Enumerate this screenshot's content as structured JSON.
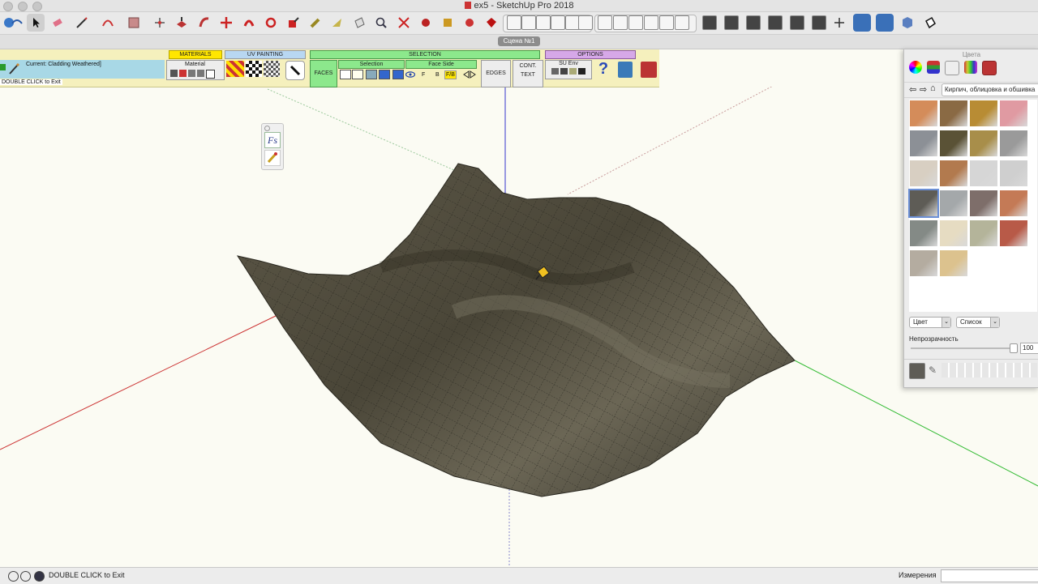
{
  "window": {
    "title": "ex5 - SketchUp Pro 2018"
  },
  "scene_tab": {
    "label": "Сцена №1"
  },
  "plugin": {
    "current_material": "Current: Cladding Weathered]",
    "instruction": "DOUBLE CLICK to Exit",
    "materials_label": "MATERIALS",
    "material_label": "Material",
    "uv_label": "UV PAINTING",
    "selection_header": "SELECTION",
    "faces_label": "FACES",
    "selection_label": "Selection",
    "face_side_label": "Face Side",
    "f_label": "F",
    "b_label": "B",
    "fb_label": "F/B",
    "edges_label": "EDGES",
    "cont_label": "CONT.",
    "text_label": "TEXT",
    "options_label": "OPTIONS",
    "su_env_label": "SU Env",
    "help_glyph": "?"
  },
  "floatbar": {
    "fs_label": "Fs"
  },
  "colors_panel": {
    "title": "Цвета",
    "library": "Кирпич, облицовка и обшивка",
    "swatches": [
      {
        "color": "#d48c5a"
      },
      {
        "color": "#8a6a44"
      },
      {
        "color": "#b88c34"
      },
      {
        "color": "#e09aa2"
      },
      {
        "color": "#8c9096"
      },
      {
        "color": "#5a5236"
      },
      {
        "color": "#a88e4a"
      },
      {
        "color": "#9a9a9a"
      },
      {
        "color": "#d8cfc2"
      },
      {
        "color": "#b27a4e"
      },
      {
        "color": "#d6d6d6"
      },
      {
        "color": "#cfcfcf"
      },
      {
        "color": "#5e5c56",
        "selected": true
      },
      {
        "color": "#a4a8aa"
      },
      {
        "color": "#7e6e6a"
      },
      {
        "color": "#c47a56"
      },
      {
        "color": "#848a86"
      },
      {
        "color": "#e6dcc2"
      },
      {
        "color": "#b4b49a"
      },
      {
        "color": "#b85a48"
      },
      {
        "color": "#b4aca0"
      },
      {
        "color": "#dcc28e"
      }
    ],
    "mode_select": "Цвет",
    "view_select": "Список",
    "opacity_label": "Непрозрачность",
    "opacity_value": "100"
  },
  "status": {
    "text": "DOUBLE CLICK to Exit",
    "measurements_label": "Измерения",
    "measurements_value": ""
  },
  "accent_colors": {
    "x_axis": "#cc3333",
    "y_axis": "#33bb33",
    "z_axis": "#3333cc",
    "surface": "#4e4a3c"
  }
}
